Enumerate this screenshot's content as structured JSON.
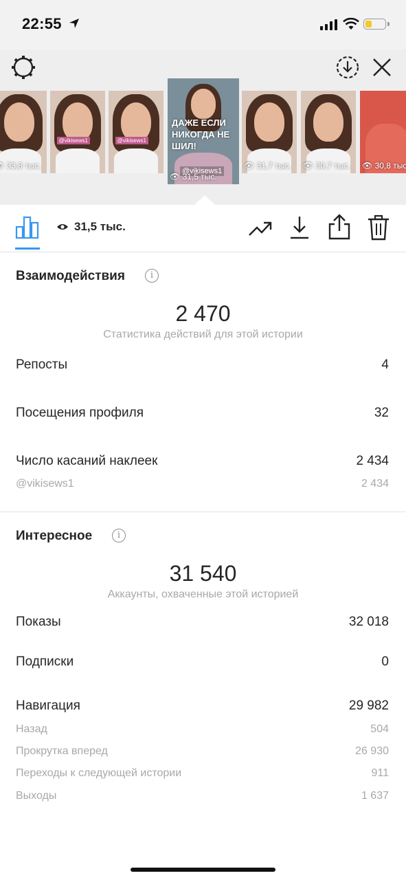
{
  "status_bar": {
    "time": "22:55",
    "location_icon": "location-arrow-icon",
    "signal_icon": "cellular-signal-icon",
    "wifi_icon": "wifi-icon",
    "battery_icon": "battery-low-icon",
    "battery_color": "#f4c92b"
  },
  "top_bar": {
    "settings_icon": "gear-icon",
    "download_icon": "download-circle-icon",
    "close_icon": "close-icon"
  },
  "thumbnails": [
    {
      "views": "33,8 тыс."
    },
    {
      "views": "",
      "tag": "@vikisews1"
    },
    {
      "views": "",
      "tag": "@vikisews1"
    },
    {
      "views": "31,5 тыс.",
      "overlay": "ДАЖЕ ЕСЛИ НИКОГДА НЕ ШИЛ!",
      "handle": "@vikisews1",
      "selected": true
    },
    {
      "views": "31,7 тыс."
    },
    {
      "views": "30,7 тыс."
    },
    {
      "views": "30,8 тыс."
    }
  ],
  "toolbar": {
    "views_count": "31,5 тыс.",
    "stats_icon": "bar-chart-icon",
    "eye_icon": "eye-icon",
    "promote_icon": "trending-up-icon",
    "save_icon": "download-icon",
    "share_icon": "share-icon",
    "delete_icon": "trash-icon",
    "accent": "#3897f0"
  },
  "interactions": {
    "title": "Взаимодействия",
    "total": "2 470",
    "caption": "Статистика действий для этой истории",
    "rows": [
      {
        "label": "Репосты",
        "value": "4"
      },
      {
        "label": "Посещения профиля",
        "value": "32"
      },
      {
        "label": "Число касаний наклеек",
        "value": "2 434"
      }
    ],
    "sub_rows": [
      {
        "label": "@vikisews1",
        "value": "2 434"
      }
    ]
  },
  "discovery": {
    "title": "Интересное",
    "total": "31 540",
    "caption": "Аккаунты, охваченные этой историей",
    "rows": [
      {
        "label": "Показы",
        "value": "32 018"
      },
      {
        "label": "Подписки",
        "value": "0"
      },
      {
        "label": "Навигация",
        "value": "29 982"
      }
    ],
    "sub_rows": [
      {
        "label": "Назад",
        "value": "504"
      },
      {
        "label": "Прокрутка вперед",
        "value": "26 930"
      },
      {
        "label": "Переходы к следующей истории",
        "value": "911"
      },
      {
        "label": "Выходы",
        "value": "1 637"
      }
    ]
  }
}
